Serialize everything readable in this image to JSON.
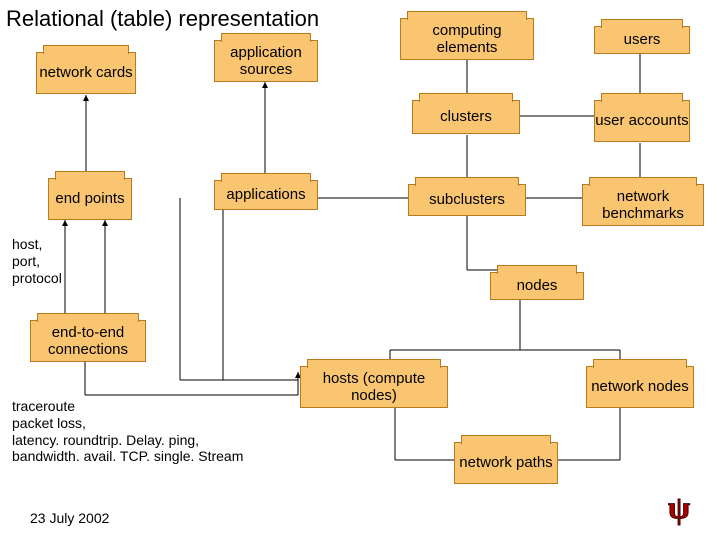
{
  "title": "Relational (table) representation",
  "boxes": {
    "network_cards": "network\ncards",
    "application_sources": "application\nsources",
    "computing_elements": "computing\nelements",
    "users": "users",
    "clusters": "clusters",
    "user_accounts": "user\naccounts",
    "end_points": "end\npoints",
    "applications": "applications",
    "subclusters": "subclusters",
    "network_benchmarks": "network\nbenchmarks",
    "nodes": "nodes",
    "end_to_end_connections": "end-to-end\nconnections",
    "hosts": "hosts\n(compute nodes)",
    "network_nodes": "network\nnodes",
    "network_paths": "network\npaths"
  },
  "labels": {
    "host_port_protocol": "host,\nport,\nprotocol",
    "metrics": "traceroute\npacket loss,\nlatency. roundtrip. Delay. ping,\nbandwidth. avail. TCP. single. Stream"
  },
  "date": "23 July 2002"
}
